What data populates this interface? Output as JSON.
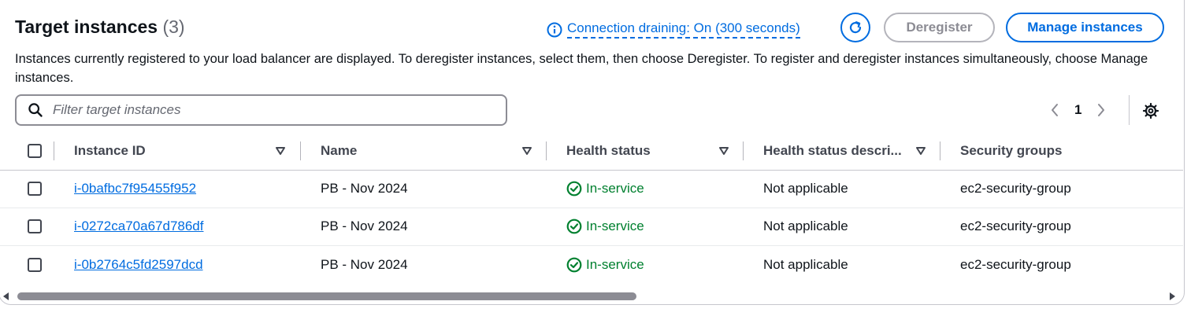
{
  "header": {
    "title": "Target instances",
    "count": "(3)",
    "connection_draining": "Connection draining: On (300 seconds)",
    "deregister_label": "Deregister",
    "manage_label": "Manage instances"
  },
  "description": "Instances currently registered to your load balancer are displayed. To deregister instances, select them, then choose Deregister. To register and deregister instances simultaneously, choose Manage instances.",
  "search": {
    "placeholder": "Filter target instances",
    "value": ""
  },
  "pagination": {
    "current_page": "1"
  },
  "table": {
    "columns": [
      "Instance ID",
      "Name",
      "Health status",
      "Health status descri...",
      "Security groups"
    ],
    "rows": [
      {
        "instance_id": "i-0bafbc7f95455f952",
        "name": "PB - Nov 2024",
        "health": "In-service",
        "health_desc": "Not applicable",
        "security_group": "ec2-security-group"
      },
      {
        "instance_id": "i-0272ca70a67d786df",
        "name": "PB - Nov 2024",
        "health": "In-service",
        "health_desc": "Not applicable",
        "security_group": "ec2-security-group"
      },
      {
        "instance_id": "i-0b2764c5fd2597dcd",
        "name": "PB - Nov 2024",
        "health": "In-service",
        "health_desc": "Not applicable",
        "security_group": "ec2-security-group"
      }
    ]
  },
  "icons": {
    "info": "info-icon",
    "refresh": "refresh-icon",
    "search": "search-icon",
    "prev": "chevron-left-icon",
    "next": "chevron-right-icon",
    "settings": "gear-icon",
    "sort": "caret-down-icon",
    "healthy": "check-circle-icon"
  },
  "colors": {
    "link": "#006ce0",
    "success": "#00802f",
    "text": "#0f141a",
    "disabled": "#8c8c94"
  }
}
